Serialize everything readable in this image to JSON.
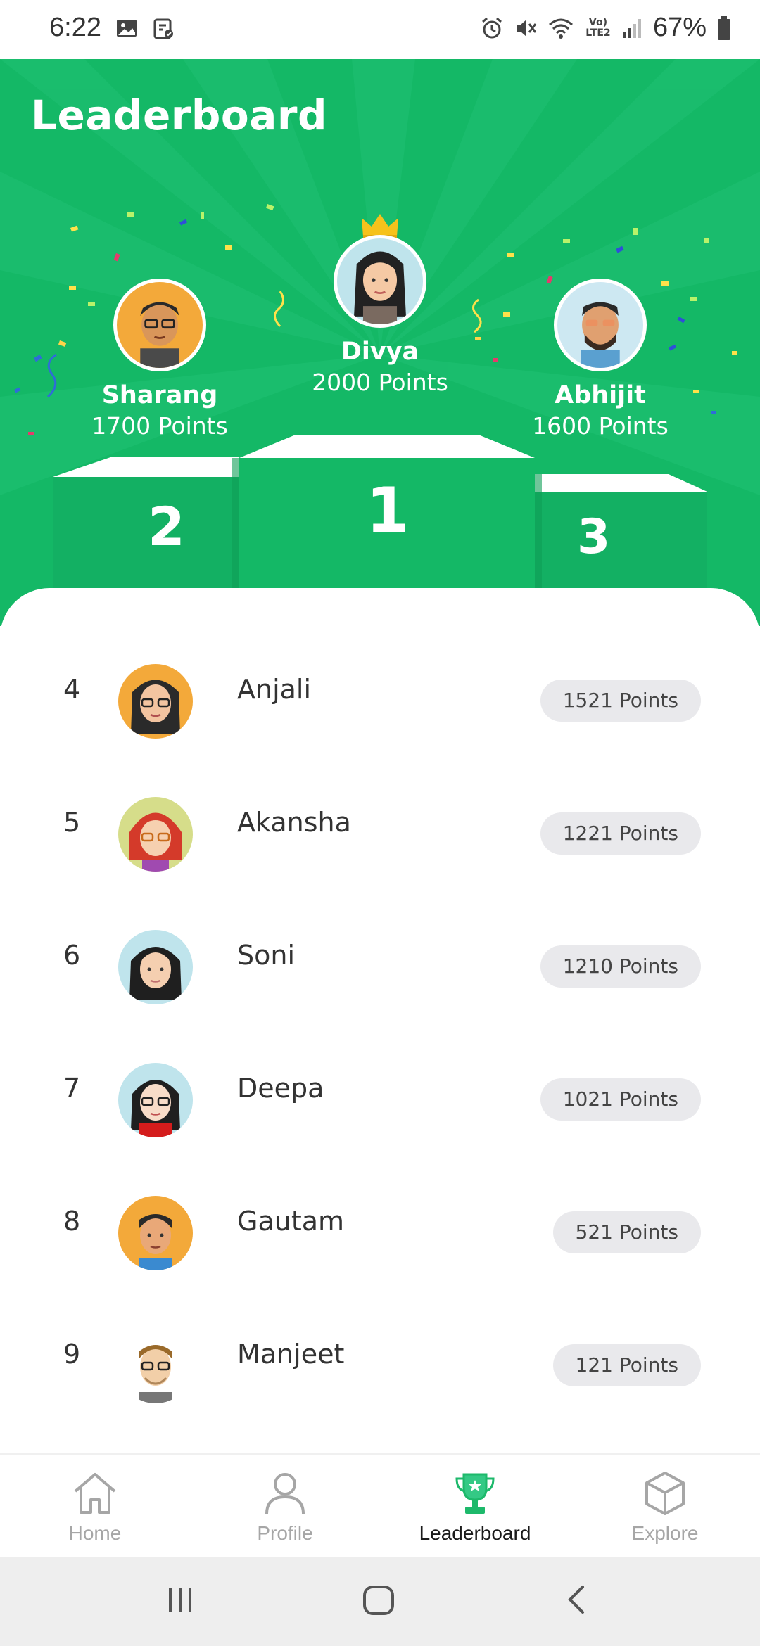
{
  "status_bar": {
    "time": "6:22",
    "battery": "67%",
    "network": "Vo) LTE2",
    "icons": [
      "image-icon",
      "clipboard-icon",
      "alarm-icon",
      "mute-icon",
      "wifi-icon",
      "signal-icon",
      "battery-icon"
    ]
  },
  "header": {
    "title": "Leaderboard",
    "background_color": "#14b866"
  },
  "podium": [
    {
      "rank": "1",
      "name": "Divya",
      "points": "2000 Points"
    },
    {
      "rank": "2",
      "name": "Sharang",
      "points": "1700 Points"
    },
    {
      "rank": "3",
      "name": "Abhijit",
      "points": "1600 Points"
    }
  ],
  "leaderboard": [
    {
      "rank": "4",
      "name": "Anjali",
      "points": "1521 Points"
    },
    {
      "rank": "5",
      "name": "Akansha",
      "points": "1221 Points"
    },
    {
      "rank": "6",
      "name": "Soni",
      "points": "1210 Points"
    },
    {
      "rank": "7",
      "name": "Deepa",
      "points": "1021 Points"
    },
    {
      "rank": "8",
      "name": "Gautam",
      "points": "521 Points"
    },
    {
      "rank": "9",
      "name": "Manjeet",
      "points": "121 Points"
    }
  ],
  "nav": {
    "items": [
      {
        "label": "Home",
        "icon": "home-icon",
        "active": false
      },
      {
        "label": "Profile",
        "icon": "profile-icon",
        "active": false
      },
      {
        "label": "Leaderboard",
        "icon": "trophy-icon",
        "active": true
      },
      {
        "label": "Explore",
        "icon": "cube-icon",
        "active": false
      }
    ],
    "active_color": "#1db96b",
    "inactive_color": "#a6a6a6"
  },
  "system_nav": [
    "recents-button",
    "home-button",
    "back-button"
  ]
}
